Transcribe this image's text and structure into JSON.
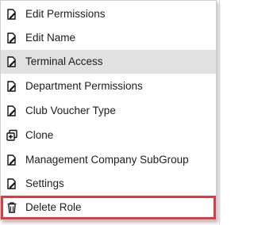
{
  "menu": {
    "items": [
      {
        "label": "Edit Permissions",
        "icon": "edit-note-icon"
      },
      {
        "label": "Edit Name",
        "icon": "edit-note-icon"
      },
      {
        "label": "Terminal Access",
        "icon": "edit-note-icon",
        "state": "highlighted"
      },
      {
        "label": "Department Permissions",
        "icon": "edit-note-icon"
      },
      {
        "label": "Club Voucher Type",
        "icon": "edit-note-icon"
      },
      {
        "label": "Clone",
        "icon": "clone-icon"
      },
      {
        "label": "Management Company SubGroup",
        "icon": "edit-note-icon"
      },
      {
        "label": "Settings",
        "icon": "edit-note-icon"
      },
      {
        "label": "Delete Role",
        "icon": "trash-icon",
        "state": "outlined"
      }
    ]
  },
  "colors": {
    "highlight_background": "#e1e1e1",
    "outline": "#e23a45",
    "text": "#1c1c1c"
  }
}
